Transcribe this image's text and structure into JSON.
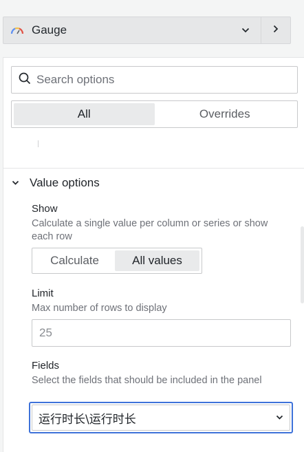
{
  "visualization": {
    "name": "Gauge",
    "icon": "gauge-icon",
    "picker_chevron_icon": "chevron-down-icon",
    "toggle_icon": "chevron-right-icon"
  },
  "options": {
    "search": {
      "placeholder": "Search options",
      "value": ""
    },
    "tabs": [
      {
        "label": "All",
        "active": true
      },
      {
        "label": "Overrides",
        "active": false
      }
    ],
    "value_options": {
      "title": "Value options",
      "collapse_icon": "chevron-down-icon",
      "show": {
        "label": "Show",
        "description": "Calculate a single value per column or series or show each row",
        "options": [
          {
            "label": "Calculate",
            "active": false
          },
          {
            "label": "All values",
            "active": true
          }
        ]
      },
      "limit": {
        "label": "Limit",
        "description": "Max number of rows to display",
        "placeholder": "25",
        "value": ""
      },
      "fields": {
        "label": "Fields",
        "description": "Select the fields that should be included in the panel",
        "value": "运行时长\\运行时长"
      }
    }
  },
  "colors": {
    "focus_border": "#3d71d9",
    "active_segment": "#e9eaeb",
    "muted_text": "#6e7178"
  }
}
